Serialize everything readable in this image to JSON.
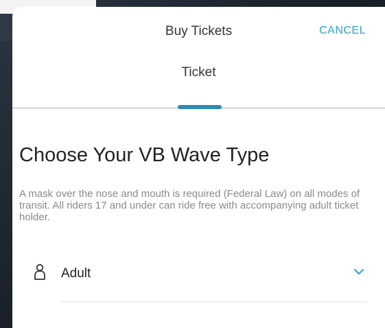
{
  "header": {
    "title": "Buy Tickets",
    "cancel_label": "CANCEL"
  },
  "steps": {
    "current_label": "Ticket"
  },
  "content": {
    "heading": "Choose Your VB Wave Type",
    "notice": "A mask over the nose and mouth is required (Federal Law) on all modes of transit. All riders 17 and under can ride free with accompanying adult ticket holder."
  },
  "rider_select": {
    "icon": "person-icon",
    "selected_value": "Adult",
    "expand_icon": "chevron-down-icon"
  },
  "colors": {
    "accent": "#2aa1cc",
    "indicator": "#2e8db3",
    "heading_text": "#222222",
    "muted_text": "#8a8a8a"
  }
}
